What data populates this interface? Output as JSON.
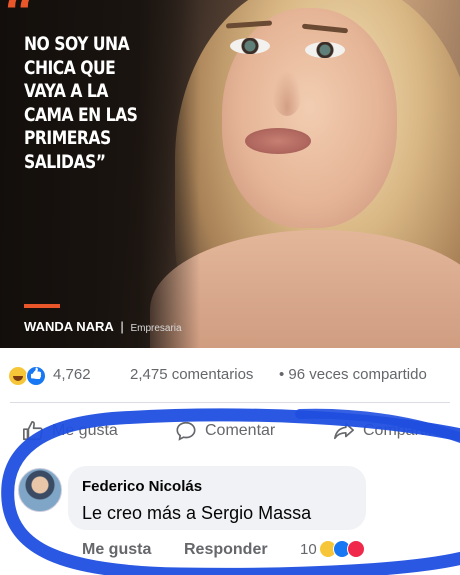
{
  "post": {
    "quote_mark": "“",
    "quote": "NO SOY UNA CHICA QUE VAYA A LA CAMA EN LAS PRIMERAS SALIDAS”",
    "caption_name": "WANDA NARA",
    "caption_sep": "|",
    "caption_role": "Empresaria",
    "accent_color": "#e8562a"
  },
  "stats": {
    "reaction_icons": [
      "haha-icon",
      "like-icon"
    ],
    "reaction_count": "4,762",
    "comments": "2,475 comentarios",
    "shares": "• 96 veces compartido"
  },
  "actions": {
    "like_label": "Me gusta",
    "comment_label": "Comentar",
    "share_label": "Compartir"
  },
  "comment": {
    "author": "Federico Nicolás",
    "text": "Le creo más a Sergio Massa",
    "like_label": "Me gusta",
    "reply_label": "Responder",
    "reaction_count": "10",
    "reaction_icons": [
      "haha-icon",
      "like-icon",
      "wow-icon"
    ]
  },
  "colors": {
    "facebook_blue": "#1877f2",
    "scribble_blue": "#1f4fe0",
    "text_gray": "#65676b"
  }
}
